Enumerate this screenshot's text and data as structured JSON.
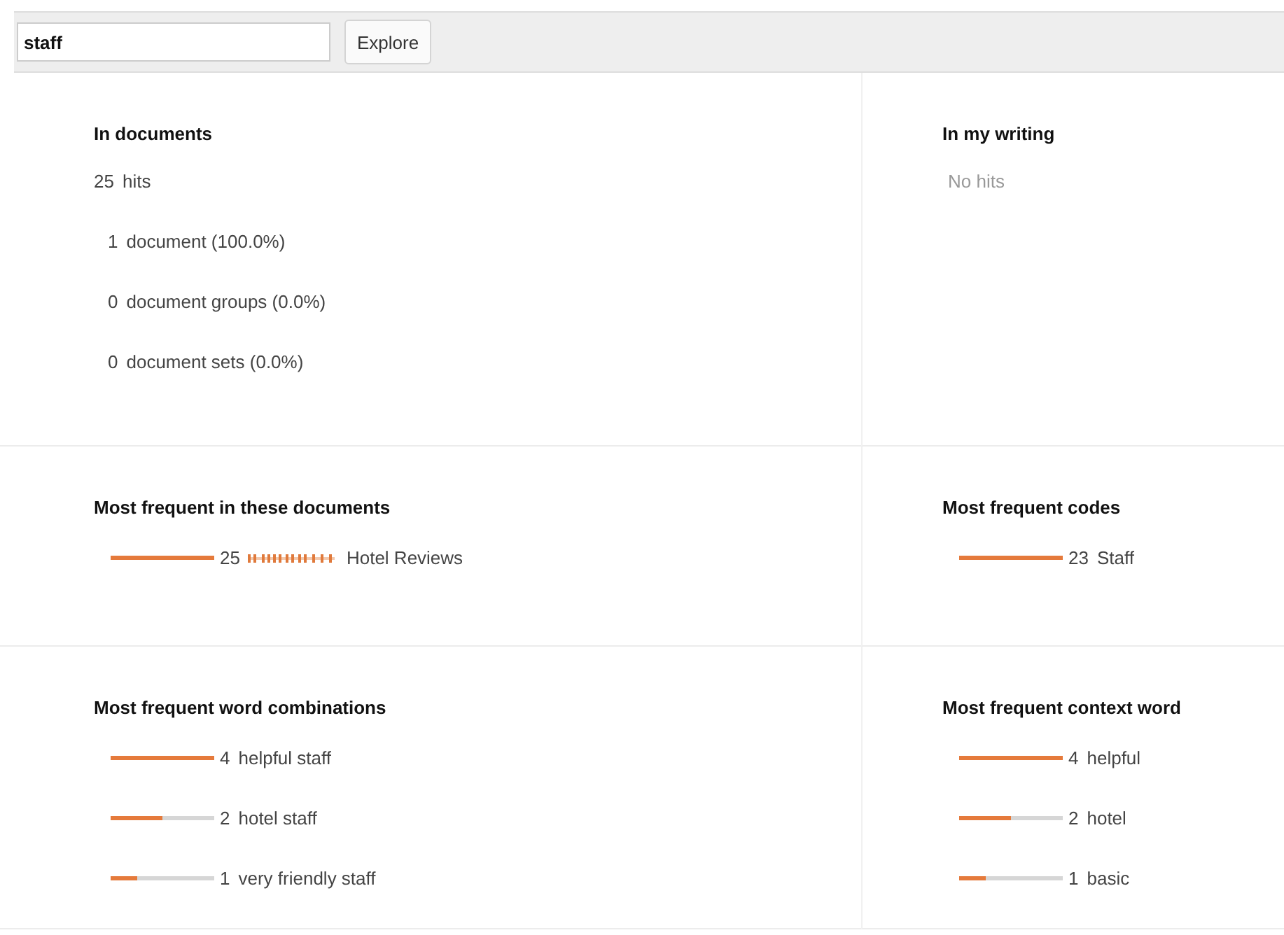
{
  "search": {
    "value": "staff",
    "button": "Explore"
  },
  "sections": [
    {
      "title": "In documents",
      "kind": "counts",
      "items": [
        {
          "count": "25",
          "label": "hits",
          "indent": false
        },
        {
          "count": "1",
          "label": "document (100.0%)",
          "indent": true
        },
        {
          "count": "0",
          "label": "document groups (0.0%)",
          "indent": true
        },
        {
          "count": "0",
          "label": "document sets (0.0%)",
          "indent": true
        }
      ]
    },
    {
      "title": "In my writing",
      "kind": "empty",
      "message": "No hits"
    },
    {
      "title": "Most frequent in these documents",
      "kind": "bars",
      "items": [
        {
          "level": 1,
          "count": "25",
          "label": "Hotel Reviews",
          "distribution": true
        }
      ]
    },
    {
      "title": "Most frequent codes",
      "kind": "bars",
      "items": [
        {
          "level": 1,
          "count": "23",
          "label": "Staff",
          "distribution": false
        }
      ]
    },
    {
      "title": "Most frequent word combinations",
      "kind": "bars",
      "items": [
        {
          "level": 1,
          "count": "4",
          "label": "helpful staff",
          "distribution": false
        },
        {
          "level": 0.5,
          "count": "2",
          "label": "hotel staff",
          "distribution": false
        },
        {
          "level": 0.25,
          "count": "1",
          "label": "very friendly staff",
          "distribution": false
        }
      ]
    },
    {
      "title": "Most frequent context word",
      "kind": "bars",
      "items": [
        {
          "level": 1,
          "count": "4",
          "label": "helpful",
          "distribution": false
        },
        {
          "level": 0.5,
          "count": "2",
          "label": "hotel",
          "distribution": false
        },
        {
          "level": 0.25,
          "count": "1",
          "label": "basic",
          "distribution": false
        }
      ]
    }
  ]
}
